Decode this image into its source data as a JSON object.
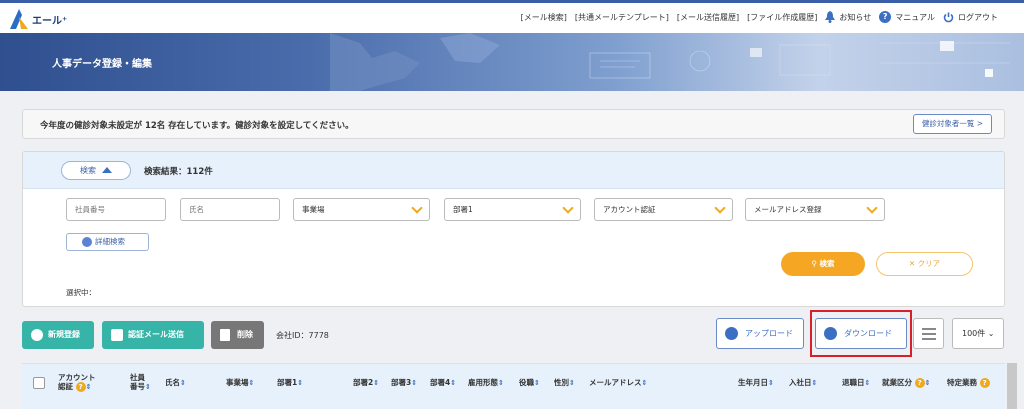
{
  "app": {
    "logo_text": "エール⁺"
  },
  "topnav": {
    "links": [
      "[メール検索]",
      "[共通メールテンプレート]",
      "[メール送信履歴]",
      "[ファイル作成履歴]"
    ],
    "notice": "お知らせ",
    "manual": "マニュアル",
    "logout": "ログアウト"
  },
  "banner": {
    "title": "人事データ登録・編集"
  },
  "alert": {
    "message": "今年度の健診対象未設定が 12名 存在しています。健診対象を設定してください。",
    "button": "健診対象者一覧 >"
  },
  "search": {
    "toggle_label": "検索",
    "result_label": "検索結果：112件",
    "fields": {
      "employee_no_placeholder": "社員番号",
      "name_placeholder": "氏名",
      "office": "事業場",
      "dept": "部署1",
      "account_auth": "アカウント認証",
      "email_registered": "メールアドレス登録"
    },
    "detail_label": "詳細検索",
    "search_label": "検索",
    "clear_label": "✕ クリア",
    "selected_label": "選択中："
  },
  "toolbar": {
    "new_label": "新規登録",
    "send_label": "認証メール送信",
    "delete_label": "削除",
    "company_label": "会社ID：7778",
    "upload_label": "アップロード",
    "download_label": "ダウンロード",
    "per_page": "100件 ⌄"
  },
  "table": {
    "headers": [
      "アカウント認証",
      "社員番号",
      "氏名",
      "事業場",
      "部署1",
      "部署2",
      "部署3",
      "部署4",
      "雇用形態",
      "役職",
      "性別",
      "メールアドレス",
      "生年月日",
      "入社日",
      "退職日",
      "就業区分",
      "特定業務"
    ]
  },
  "colors": {
    "accent": "#3b6fc4",
    "teal": "#36b4a8",
    "orange": "#f5a623",
    "highlight": "#d8202a"
  }
}
